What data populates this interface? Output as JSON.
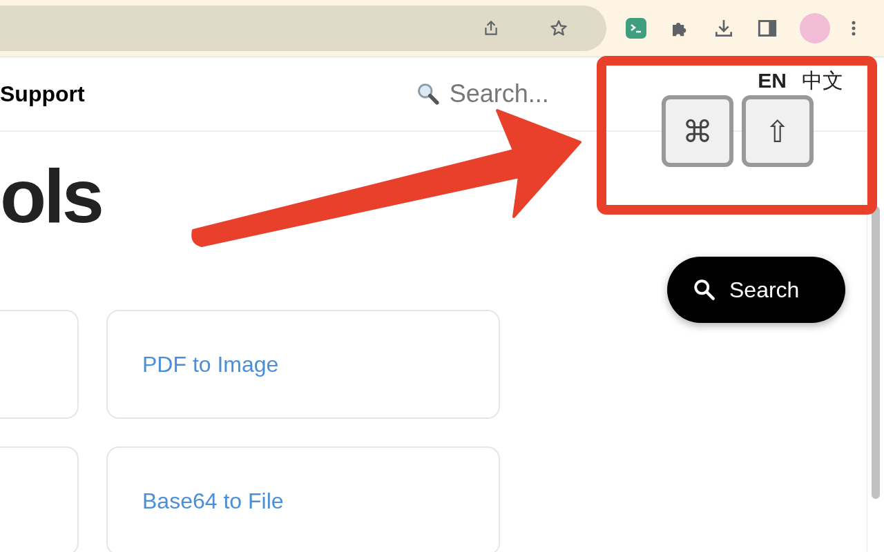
{
  "nav": {
    "link": "Support",
    "search": {
      "placeholder": "Search..."
    },
    "languages": [
      {
        "label": "EN",
        "selected": true
      },
      {
        "label": "中文",
        "selected": false
      }
    ]
  },
  "heading": "ols",
  "cards": [
    {
      "title": "PDF to Image"
    },
    {
      "title": "Base64 to File"
    }
  ],
  "search_button": {
    "label": "Search"
  },
  "annotation": {
    "keys": [
      "⌘",
      "⇧"
    ]
  }
}
